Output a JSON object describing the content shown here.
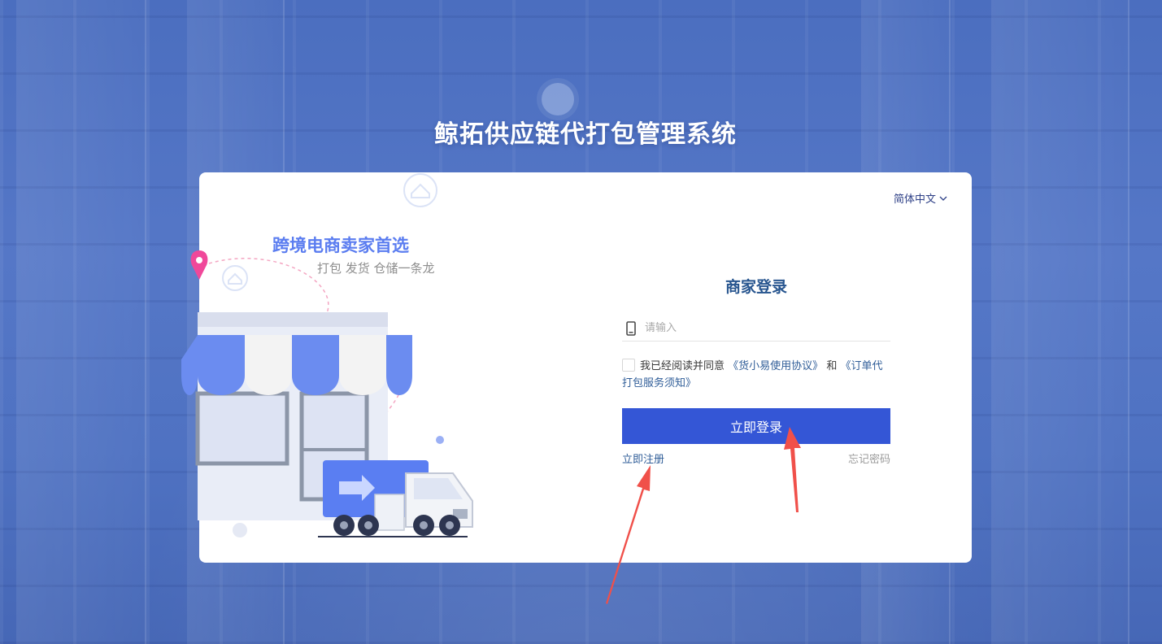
{
  "page": {
    "title": "鲸拓供应链代打包管理系统"
  },
  "language_selector": {
    "label": "简体中文"
  },
  "promo": {
    "slogan": "跨境电商卖家首选",
    "sub_slogan": "打包 发货 仓储一条龙"
  },
  "login": {
    "title": "商家登录",
    "phone_placeholder": "请输入",
    "agreement": {
      "prefix": "我已经阅读并同意",
      "link_usage": "《货小易使用协议》",
      "conjunction": "和",
      "link_service": "《订单代打包服务须知》"
    },
    "submit_label": "立即登录",
    "register_label": "立即注册",
    "forgot_label": "忘记密码"
  },
  "colors": {
    "primary": "#3456d6",
    "link": "#2f5d98",
    "title": "#27558f",
    "slogan": "#5b7df0",
    "annotation_arrow": "#f0504a"
  }
}
